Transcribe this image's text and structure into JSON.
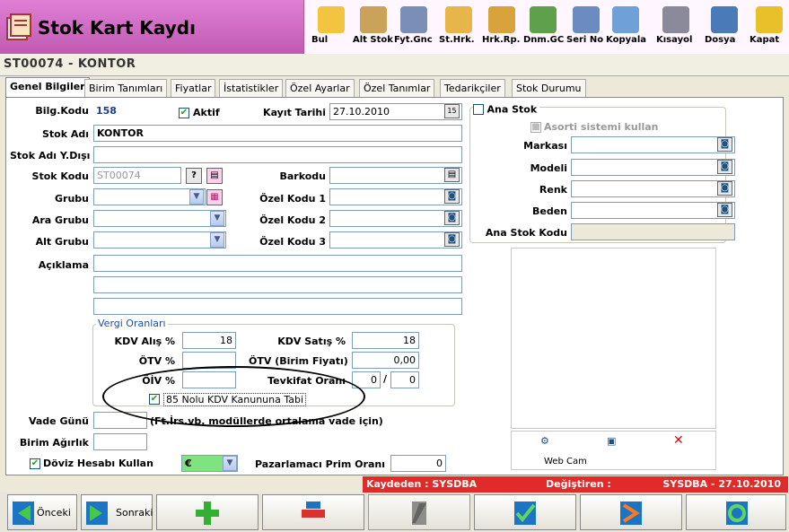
{
  "window": {
    "title": "Stok Kart Kaydı",
    "record": "ST00074 - KONTOR"
  },
  "toolbar": [
    {
      "label": "Bul",
      "icon": "search-icon",
      "color": "#f3c440"
    },
    {
      "label": "Alt Stok",
      "icon": "boxes-icon",
      "color": "#caa25a"
    },
    {
      "label": "Fyt.Gnc",
      "icon": "price-update-icon",
      "color": "#7a8fb5"
    },
    {
      "label": "St.Hrk.",
      "icon": "stock-movement-icon",
      "color": "#e7b64b"
    },
    {
      "label": "Hrk.Rp.",
      "icon": "report-icon",
      "color": "#d8a33b"
    },
    {
      "label": "Dnm.GC",
      "icon": "period-icon",
      "color": "#5fa14a"
    },
    {
      "label": "Seri No",
      "icon": "serial-icon",
      "color": "#6a8cc0"
    },
    {
      "label": "Kopyala",
      "icon": "copy-icon",
      "color": "#6fa0d8"
    },
    {
      "label": "Kısayol",
      "icon": "shortcut-icon",
      "color": "#8a8a9a"
    },
    {
      "label": "Dosya",
      "icon": "file-icon",
      "color": "#4a7ab8"
    },
    {
      "label": "Kapat",
      "icon": "exit-icon",
      "color": "#e8c12a"
    }
  ],
  "tabs": [
    "Genel Bilgiler",
    "Birim Tanımları",
    "Fiyatlar",
    "İstatistikler",
    "Özel Ayarlar",
    "Özel Tanımlar",
    "Tedarikçiler",
    "Stok Durumu"
  ],
  "form": {
    "bilg_kodu_label": "Bilg.Kodu",
    "bilg_kodu": "158",
    "aktif_label": "Aktif",
    "kayit_tarihi_label": "Kayıt Tarihi",
    "kayit_tarihi": "27.10.2010",
    "stok_adi_label": "Stok Adı",
    "stok_adi": "KONTOR",
    "stok_adi_ydisi_label": "Stok Adı Y.Dışı",
    "stok_adi_ydisi": "",
    "stok_kodu_label": "Stok Kodu",
    "stok_kodu": "ST00074",
    "barkodu_label": "Barkodu",
    "barkodu": "",
    "grubu_label": "Grubu",
    "grubu": "",
    "ozel_kodu1_label": "Özel Kodu 1",
    "ozel_kodu1": "",
    "ara_grubu_label": "Ara Grubu",
    "ara_grubu": "",
    "ozel_kodu2_label": "Özel Kodu 2",
    "ozel_kodu2": "",
    "alt_grubu_label": "Alt Grubu",
    "alt_grubu": "",
    "ozel_kodu3_label": "Özel Kodu 3",
    "ozel_kodu3": "",
    "aciklama_label": "Açıklama",
    "vade_gunu_label": "Vade Günü",
    "vade_note": "(Ft.İrs.vb. modüllerde ortalama vade için)",
    "birim_agirlik_label": "Birim Ağırlık",
    "doviz_label": "Döviz Hesabı Kullan",
    "doviz": "€",
    "pazarlamaci_label": "Pazarlamacı Prim Oranı",
    "pazarlamaci": "0"
  },
  "vergi": {
    "title": "Vergi Oranları",
    "kdv_alis_label": "KDV Alış %",
    "kdv_alis": "18",
    "kdv_satis_label": "KDV Satış %",
    "kdv_satis": "18",
    "otv_label": "ÖTV %",
    "otv": "",
    "otv_birim_label": "ÖTV (Birim Fiyatı)",
    "otv_birim": "0,00",
    "oiv_label": "ÖİV %",
    "oiv": "",
    "tevkifat_label": "Tevkifat Oranı",
    "tevkifat1": "0",
    "tevkifat2": "0",
    "kanun_label": "85 Nolu KDV Kanununa Tabi"
  },
  "ana_stok": {
    "label": "Ana Stok",
    "asorti_label": "Asorti sistemi kullan",
    "markasi_label": "Markası",
    "modeli_label": "Modeli",
    "renk_label": "Renk",
    "beden_label": "Beden",
    "ana_stok_kodu_label": "Ana Stok Kodu"
  },
  "webcam": {
    "label": "Web Cam"
  },
  "status": {
    "kaydeden": "Kaydeden : SYSDBA",
    "degistiren_label": "Değiştiren :",
    "degistiren": "SYSDBA - 27.10.2010"
  },
  "nav": {
    "prev": "Önceki",
    "next": "Sonraki"
  }
}
